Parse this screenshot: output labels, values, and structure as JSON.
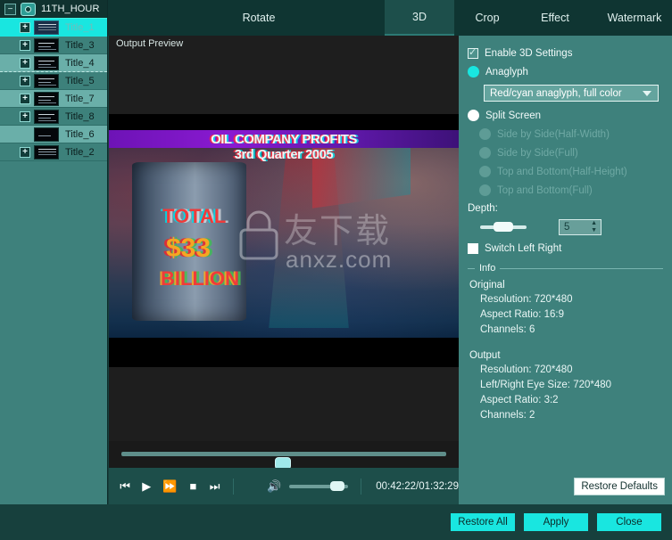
{
  "sidebar": {
    "root_label": "11TH_HOUR",
    "root_icon": "disc-icon",
    "collapse_icon": "minus-icon",
    "items": [
      {
        "label": "Title_1",
        "expandable": true,
        "selected": true,
        "style": "selected"
      },
      {
        "label": "Title_3",
        "expandable": true,
        "selected": false,
        "style": "dark"
      },
      {
        "label": "Title_4",
        "expandable": true,
        "selected": false,
        "style": "alt"
      },
      {
        "label": "Title_5",
        "expandable": true,
        "selected": false,
        "style": "dark"
      },
      {
        "label": "Title_7",
        "expandable": true,
        "selected": false,
        "style": "alt"
      },
      {
        "label": "Title_8",
        "expandable": true,
        "selected": false,
        "style": "dark"
      },
      {
        "label": "Title_6",
        "expandable": false,
        "selected": false,
        "style": "alt"
      },
      {
        "label": "Title_2",
        "expandable": true,
        "selected": false,
        "style": "dark"
      }
    ]
  },
  "tabs": [
    {
      "label": "Rotate",
      "active": false
    },
    {
      "label": "3D",
      "active": true
    },
    {
      "label": "Crop",
      "active": false
    },
    {
      "label": "Effect",
      "active": false
    },
    {
      "label": "Watermark",
      "active": false
    }
  ],
  "preview": {
    "title": "Output Preview",
    "video_text": {
      "line1": "OIL COMPANY PROFITS",
      "line2": "3rd Quarter 2005",
      "line3": "TOTAL",
      "line4": "$33",
      "line5": "BILLION"
    },
    "watermark": {
      "site": "anxz.com",
      "cn": "友下载",
      "icon": "lock-icon"
    },
    "transport": {
      "prev_icon": "skip-previous-icon",
      "play_icon": "play-icon",
      "forward_icon": "fast-forward-icon",
      "stop_icon": "stop-icon",
      "next_icon": "skip-next-icon",
      "volume_icon": "speaker-icon",
      "timecode": "00:42:22/01:32:29"
    }
  },
  "settings": {
    "enable_3d": {
      "label": "Enable 3D Settings",
      "checked": true
    },
    "anaglyph": {
      "label": "Anaglyph",
      "selected": true
    },
    "anaglyph_mode": {
      "value": "Red/cyan anaglyph, full color",
      "arrow_icon": "chevron-down-icon"
    },
    "split_screen": {
      "label": "Split Screen",
      "selected": false
    },
    "split_options": [
      "Side by Side(Half-Width)",
      "Side by Side(Full)",
      "Top and Bottom(Half-Height)",
      "Top and Bottom(Full)"
    ],
    "depth": {
      "label": "Depth:",
      "value": "5"
    },
    "switch_left_right": {
      "label": "Switch Left Right",
      "checked": false
    },
    "info": {
      "legend": "Info",
      "original_head": "Original",
      "original": [
        "Resolution: 720*480",
        "Aspect Ratio: 16:9",
        "Channels: 6"
      ],
      "output_head": "Output",
      "output": [
        "Resolution: 720*480",
        "Left/Right Eye Size: 720*480",
        "Aspect Ratio: 3:2",
        "Channels: 2"
      ]
    },
    "restore_defaults": "Restore Defaults"
  },
  "bottom_buttons": [
    {
      "label": "Restore All"
    },
    {
      "label": "Apply"
    },
    {
      "label": "Close"
    }
  ],
  "colors": {
    "accent_cyan": "#19e6e0",
    "panel_teal": "#3e817c",
    "window_dark": "#17403d",
    "tab_active": "#1d4f4b"
  }
}
